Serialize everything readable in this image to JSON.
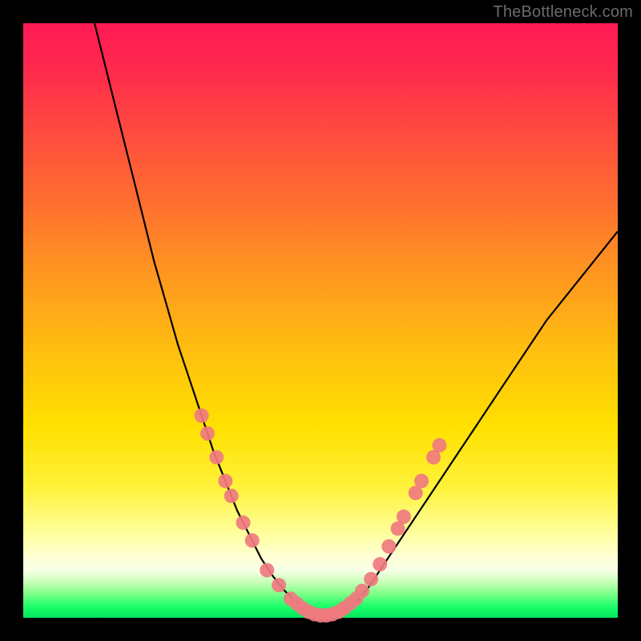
{
  "watermark": "TheBottleneck.com",
  "chart_data": {
    "type": "line",
    "title": "",
    "xlabel": "",
    "ylabel": "",
    "xlim": [
      0,
      100
    ],
    "ylim": [
      0,
      100
    ],
    "grid": false,
    "legend": false,
    "series": [
      {
        "name": "bottleneck-curve",
        "x": [
          12,
          14,
          16,
          18,
          20,
          22,
          24,
          26,
          28,
          30,
          32,
          34,
          36,
          38,
          40,
          42,
          44,
          46,
          48,
          50,
          52,
          54,
          56,
          58,
          60,
          64,
          68,
          72,
          76,
          80,
          84,
          88,
          92,
          96,
          100
        ],
        "y": [
          100,
          92,
          84,
          76,
          68,
          60,
          53,
          46,
          40,
          34,
          28,
          23,
          18,
          14,
          10,
          7,
          4.5,
          2.6,
          1.2,
          0.4,
          0.4,
          1.2,
          2.6,
          5,
          8,
          14,
          20,
          26,
          32,
          38,
          44,
          50,
          55,
          60,
          65
        ]
      }
    ],
    "markers": {
      "name": "highlight-points",
      "color": "#f07a7f",
      "points": [
        {
          "x": 30,
          "y": 34
        },
        {
          "x": 31,
          "y": 31
        },
        {
          "x": 32.5,
          "y": 27
        },
        {
          "x": 34,
          "y": 23
        },
        {
          "x": 35,
          "y": 20.5
        },
        {
          "x": 37,
          "y": 16
        },
        {
          "x": 38.5,
          "y": 13
        },
        {
          "x": 41,
          "y": 8
        },
        {
          "x": 43,
          "y": 5.5
        },
        {
          "x": 45,
          "y": 3.2
        },
        {
          "x": 46,
          "y": 2.4
        },
        {
          "x": 47,
          "y": 1.6
        },
        {
          "x": 48,
          "y": 1.0
        },
        {
          "x": 49,
          "y": 0.6
        },
        {
          "x": 50,
          "y": 0.4
        },
        {
          "x": 51,
          "y": 0.4
        },
        {
          "x": 52,
          "y": 0.6
        },
        {
          "x": 53,
          "y": 1.0
        },
        {
          "x": 54,
          "y": 1.6
        },
        {
          "x": 55,
          "y": 2.4
        },
        {
          "x": 56,
          "y": 3.2
        },
        {
          "x": 57,
          "y": 4.5
        },
        {
          "x": 58.5,
          "y": 6.5
        },
        {
          "x": 60,
          "y": 9
        },
        {
          "x": 61.5,
          "y": 12
        },
        {
          "x": 63,
          "y": 15
        },
        {
          "x": 64,
          "y": 17
        },
        {
          "x": 66,
          "y": 21
        },
        {
          "x": 67,
          "y": 23
        },
        {
          "x": 69,
          "y": 27
        },
        {
          "x": 70,
          "y": 29
        }
      ]
    }
  }
}
